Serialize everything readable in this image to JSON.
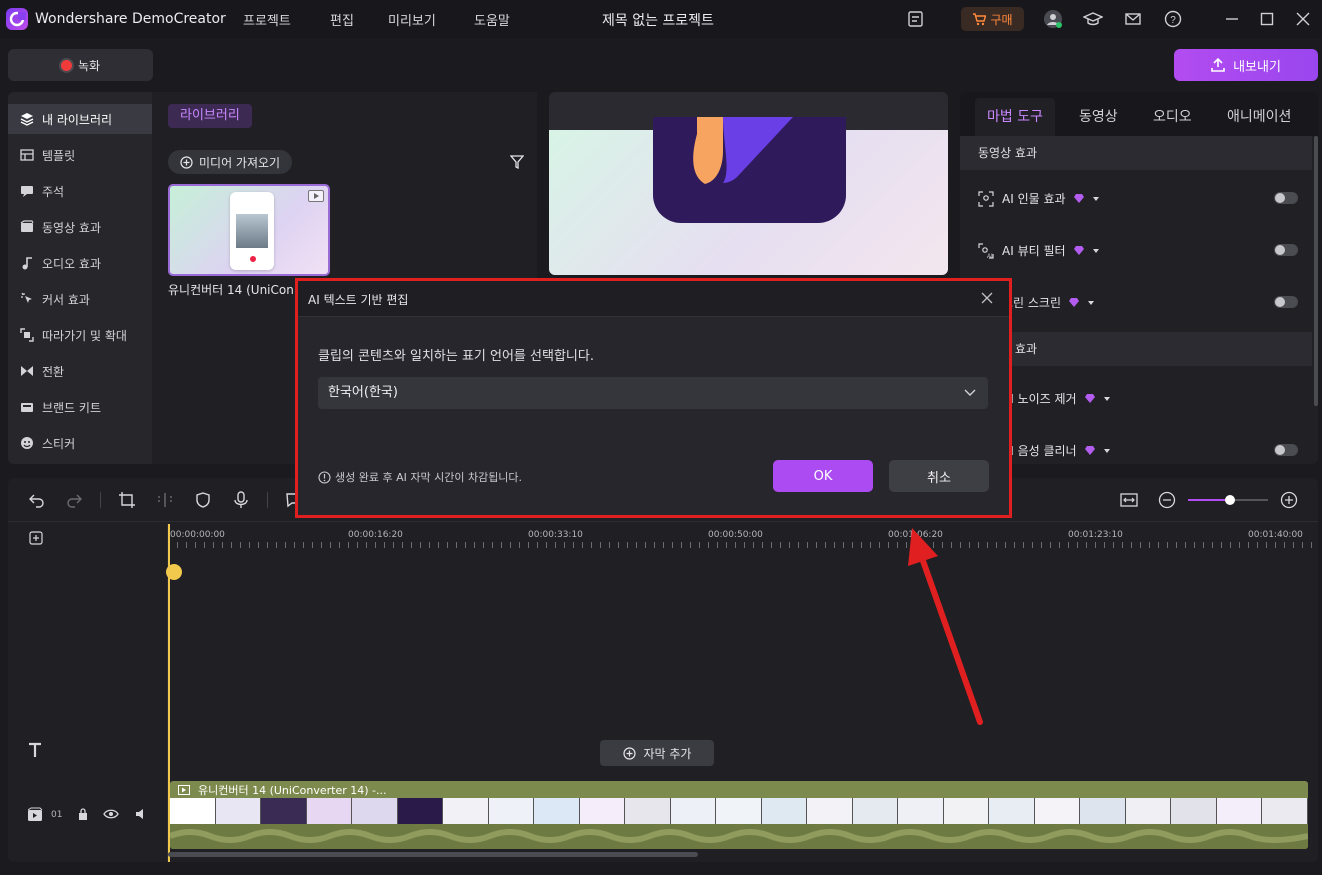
{
  "app": {
    "name": "Wondershare DemoCreator",
    "project_title": "제목 없는 프로젝트",
    "menu": [
      "프로젝트",
      "편집",
      "미리보기",
      "도움말"
    ],
    "buy_label": "구매"
  },
  "toolbar": {
    "record_label": "녹화",
    "export_label": "내보내기"
  },
  "sidebar": {
    "items": [
      {
        "label": "내 라이브러리",
        "icon": "layers-icon",
        "active": true
      },
      {
        "label": "템플릿",
        "icon": "template-icon"
      },
      {
        "label": "주석",
        "icon": "annotation-icon"
      },
      {
        "label": "동영상 효과",
        "icon": "video-effect-icon"
      },
      {
        "label": "오디오 효과",
        "icon": "music-note-icon"
      },
      {
        "label": "커서 효과",
        "icon": "cursor-icon"
      },
      {
        "label": "따라가기 및 확대",
        "icon": "zoom-follow-icon"
      },
      {
        "label": "전환",
        "icon": "transition-icon"
      },
      {
        "label": "브랜드 키트",
        "icon": "brand-kit-icon"
      },
      {
        "label": "스티커",
        "icon": "sticker-icon"
      }
    ]
  },
  "library": {
    "tab_label": "라이브러리",
    "import_label": "미디어 가져오기",
    "media": [
      {
        "name": "유니컨버터 14 (UniCon"
      }
    ]
  },
  "right_panel": {
    "tabs": [
      "마법 도구",
      "동영상",
      "오디오",
      "애니메이션"
    ],
    "sections": [
      {
        "title": "동영상 효과",
        "features": [
          {
            "label": "AI 인물 효과",
            "icon": "portrait-icon"
          },
          {
            "label": "AI 뷰티 필터",
            "icon": "beauty-icon"
          },
          {
            "label": "그린 스크린",
            "icon": "green-screen-icon"
          }
        ]
      },
      {
        "title": "오디오 효과",
        "features": [
          {
            "label": "AI 노이즈 제거",
            "icon": "noise-icon"
          },
          {
            "label": "AI 음성 클리너",
            "icon": "voice-icon"
          }
        ]
      }
    ]
  },
  "timeline": {
    "ruler_labels": [
      "00:00:00:00",
      "00:00:16:20",
      "00:00:33:10",
      "00:00:50:00",
      "00:01:06:20",
      "00:01:23:10",
      "00:01:40:00"
    ],
    "add_subtitle_label": "자막 추가",
    "track_number": "01",
    "clip_title": "유니컨버터 14 (UniConverter 14) -..."
  },
  "dialog": {
    "title": "AI 텍스트 기반 편집",
    "description": "클립의 콘텐츠와 일치하는 표기 언어를 선택합니다.",
    "language_value": "한국어(한국)",
    "info_text": "생성 완료 후 AI 자막 시간이 차감됩니다.",
    "ok_label": "OK",
    "cancel_label": "취소"
  },
  "colors": {
    "accent": "#b24cf0",
    "highlight_border": "#e02020",
    "clip_green": "#7d8a4d"
  }
}
